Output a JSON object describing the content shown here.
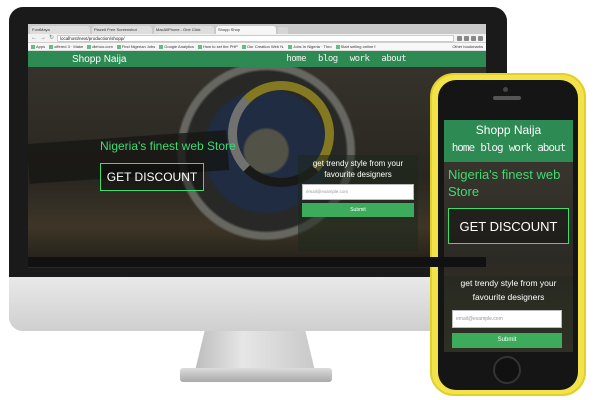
{
  "browser": {
    "tabs": [
      "FontMaya",
      "Placeit Free Screenshot",
      "MacAllPhone - One Click",
      "Shopp Shop"
    ],
    "url": "localhost/next/production/shopp/",
    "bookmarks": [
      "Apps",
      "offered 3 · Make",
      "dlehoo.com",
      "Find Nigerian Jobs",
      "Google Analytics",
      "How to set the PHP",
      "Our Creation Web N.",
      "Jobs In Nigeria · Thro",
      "Start selling online f"
    ],
    "other_bookmarks": "Other bookmarks"
  },
  "site": {
    "brand": "Shopp Naija",
    "menu": [
      "home",
      "blog",
      "work",
      "about"
    ],
    "hero_title": "Nigeria's finest web Store",
    "discount_label": "GET DISCOUNT",
    "signup_text": "get trendy style from your favourite designers",
    "email_placeholder": "email@example.com",
    "submit_label": "Submit"
  },
  "colors": {
    "nav_green": "#2e8a53",
    "accent_green": "#3ddc70",
    "button_green": "#3dab5c",
    "phone_body": "#f3e34a"
  }
}
